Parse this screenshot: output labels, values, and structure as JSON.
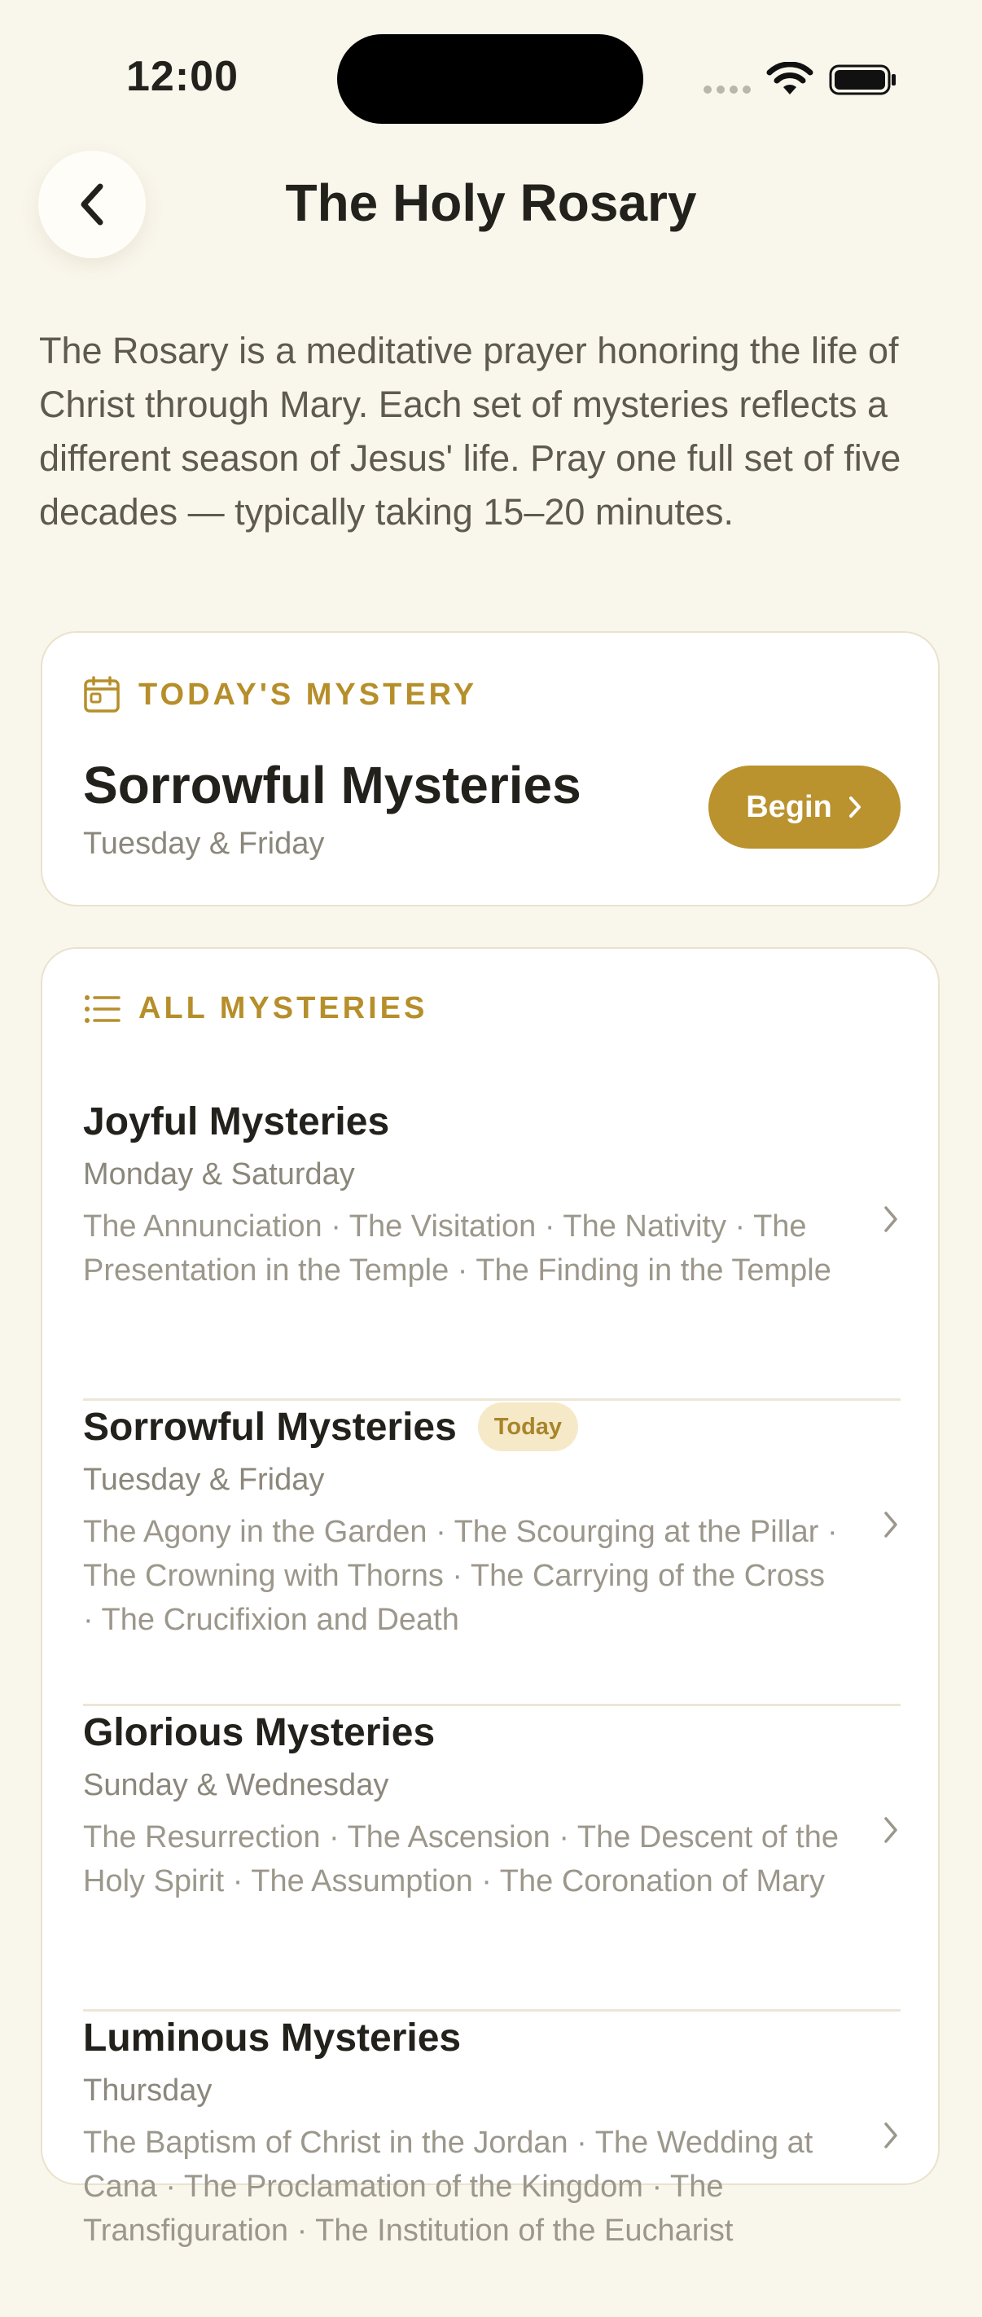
{
  "status_bar": {
    "time": "12:00"
  },
  "header": {
    "title": "The Holy Rosary"
  },
  "intro": "The Rosary is a meditative prayer honoring the life of Christ through Mary. Each set of mysteries reflects a different season of Jesus' life. Pray one full set of five decades — typically taking 15–20 minutes.",
  "today": {
    "label": "TODAY'S MYSTERY",
    "title": "Sorrowful Mysteries",
    "days": "Tuesday & Friday",
    "begin_label": "Begin"
  },
  "all": {
    "label": "ALL MYSTERIES",
    "items": [
      {
        "title": "Joyful Mysteries",
        "days": "Monday & Saturday",
        "desc": "The Annunciation · The Visitation · The Nativity · The Presentation in the Temple · The Finding in the Temple",
        "badge": ""
      },
      {
        "title": "Sorrowful Mysteries",
        "days": "Tuesday & Friday",
        "desc": "The Agony in the Garden · The Scourging at the Pillar · The Crowning with Thorns · The Carrying of the Cross · The Crucifixion and Death",
        "badge": "Today"
      },
      {
        "title": "Glorious Mysteries",
        "days": "Sunday & Wednesday",
        "desc": "The Resurrection · The Ascension · The Descent of the Holy Spirit · The Assumption · The Coronation of Mary",
        "badge": ""
      },
      {
        "title": "Luminous Mysteries",
        "days": "Thursday",
        "desc": "The Baptism of Christ in the Jordan · The Wedding at Cana · The Proclamation of the Kingdom · The Transfiguration · The Institution of the Eucharist",
        "badge": ""
      }
    ]
  },
  "colors": {
    "accent": "#BA922E",
    "background": "#F9F6EC",
    "badge_bg": "#F5E9C8"
  }
}
